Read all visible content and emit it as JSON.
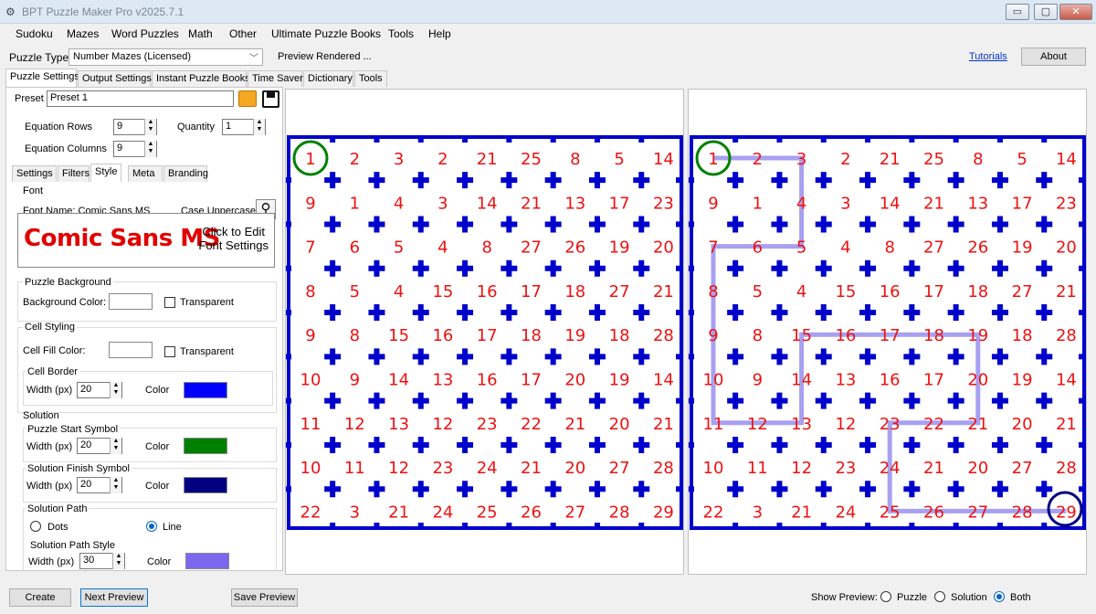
{
  "window": {
    "title": "BPT Puzzle Maker Pro v2025.7.1",
    "min": "▭",
    "max": "▢",
    "close": "✕"
  },
  "menu": [
    "Sudoku",
    "Mazes",
    "Word Puzzles",
    "Math",
    "Other",
    "Ultimate Puzzle Books",
    "Tools",
    "Help"
  ],
  "puzzle_type": {
    "label": "Puzzle Type",
    "value": "Number Mazes (Licensed)",
    "status": "Preview Rendered ..."
  },
  "links": {
    "tutorials": "Tutorials",
    "about": "About"
  },
  "main_tabs": [
    "Puzzle Settings",
    "Output Settings",
    "Instant Puzzle Books",
    "Time Saver",
    "Dictionary",
    "Tools"
  ],
  "preset": {
    "label": "Preset",
    "value": "Preset 1"
  },
  "equation_rows": {
    "label": "Equation Rows",
    "value": "9"
  },
  "equation_columns": {
    "label": "Equation Columns",
    "value": "9"
  },
  "quantity": {
    "label": "Quantity",
    "value": "1"
  },
  "sub_tabs": [
    "Settings",
    "Filters",
    "Style",
    "Meta",
    "Branding"
  ],
  "font": {
    "group": "Font",
    "name_label": "Font Name: Comic Sans MS",
    "case_label": "Case Uppercase",
    "preview": "Comic Sans MS",
    "edit_line1": "Click to Edit",
    "edit_line2": "Font Settings"
  },
  "puzzle_background": {
    "group": "Puzzle Background",
    "color_label": "Background Color:",
    "transparent": "Transparent"
  },
  "cell_styling": {
    "group": "Cell Styling",
    "fill_label": "Cell Fill Color:",
    "transparent": "Transparent",
    "border_group": "Cell Border",
    "width_label": "Width (px)",
    "width_value": "20",
    "color_label": "Color",
    "color": "#0000ff"
  },
  "solution": {
    "group": "Solution",
    "start_group": "Puzzle Start Symbol",
    "start_width": "20",
    "start_color": "#008000",
    "finish_group": "Solution Finish Symbol",
    "finish_width": "20",
    "finish_color": "#000080",
    "path_group": "Solution Path",
    "dots": "Dots",
    "line": "Line",
    "path_style_group": "Solution Path Style",
    "path_width": "30",
    "path_color": "#7b68ee",
    "width_label": "Width (px)",
    "color_label": "Color"
  },
  "grid": [
    [
      1,
      2,
      3,
      2,
      21,
      25,
      8,
      5,
      14
    ],
    [
      9,
      1,
      4,
      3,
      14,
      21,
      13,
      17,
      23
    ],
    [
      7,
      6,
      5,
      4,
      8,
      27,
      26,
      19,
      20
    ],
    [
      8,
      5,
      4,
      15,
      16,
      17,
      18,
      27,
      21
    ],
    [
      9,
      8,
      15,
      16,
      17,
      18,
      19,
      18,
      28
    ],
    [
      10,
      9,
      14,
      13,
      16,
      17,
      20,
      19,
      14
    ],
    [
      11,
      12,
      13,
      12,
      23,
      22,
      21,
      20,
      21
    ],
    [
      10,
      11,
      12,
      23,
      24,
      21,
      20,
      27,
      28
    ],
    [
      22,
      3,
      21,
      24,
      25,
      26,
      27,
      28,
      29
    ]
  ],
  "solution_path": [
    [
      0,
      0
    ],
    [
      0,
      1
    ],
    [
      0,
      2
    ],
    [
      1,
      2
    ],
    [
      2,
      2
    ],
    [
      2,
      1
    ],
    [
      2,
      0
    ],
    [
      3,
      0
    ],
    [
      4,
      0
    ],
    [
      5,
      0
    ],
    [
      6,
      0
    ],
    [
      6,
      1
    ],
    [
      6,
      2
    ],
    [
      5,
      2
    ],
    [
      4,
      2
    ],
    [
      4,
      3
    ],
    [
      4,
      4
    ],
    [
      4,
      5
    ],
    [
      4,
      6
    ],
    [
      5,
      6
    ],
    [
      6,
      6
    ],
    [
      6,
      5
    ],
    [
      6,
      4
    ],
    [
      7,
      4
    ],
    [
      8,
      4
    ],
    [
      8,
      5
    ],
    [
      8,
      6
    ],
    [
      8,
      7
    ],
    [
      8,
      8
    ]
  ],
  "bottom": {
    "create": "Create",
    "next": "Next Preview",
    "save": "Save Preview",
    "show_label": "Show Preview:",
    "puzzle": "Puzzle",
    "solution": "Solution",
    "both": "Both"
  }
}
